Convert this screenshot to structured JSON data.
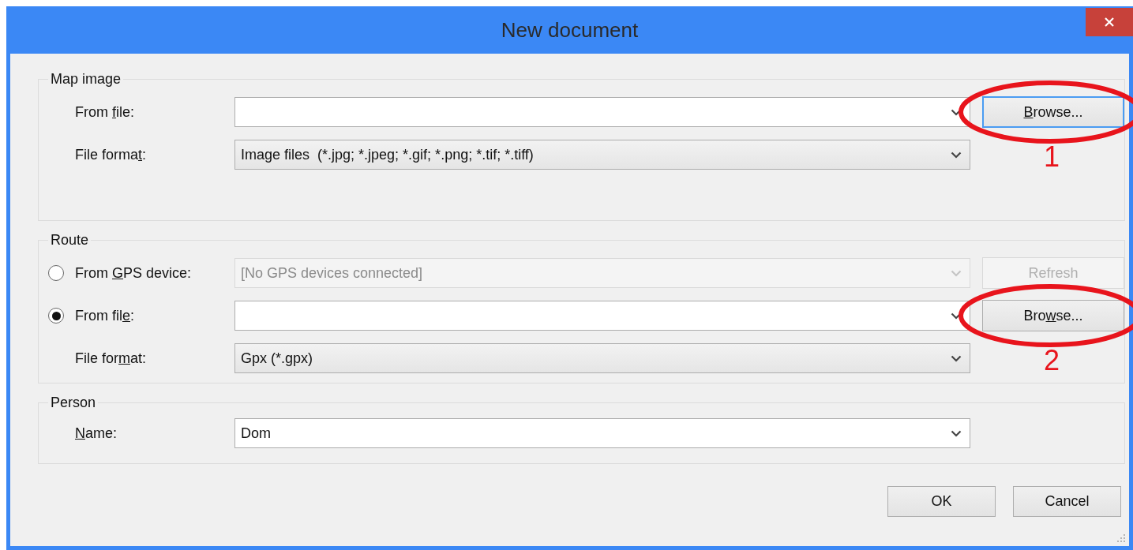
{
  "window": {
    "title": "New document"
  },
  "groups": [
    {
      "title": "Map image",
      "rows": [
        {
          "label": {
            "before": "From ",
            "key": "f",
            "after": "ile:"
          },
          "field": {
            "kind": "editable",
            "disabled": false
          },
          "button": {
            "key": "B",
            "after": "rowse...",
            "focused": true,
            "disabled": false,
            "annotation": "1"
          }
        },
        {
          "label": {
            "before": "File forma",
            "key": "t",
            "after": ":"
          },
          "field": {
            "kind": "dropdown",
            "value": "Image files  (*.jpg; *.jpeg; *.gif; *.png; *.tif; *.tiff)",
            "disabled": false
          }
        }
      ]
    },
    {
      "title": "Route",
      "rows": [
        {
          "radio": {
            "selected": false
          },
          "label": {
            "before": "From ",
            "key": "G",
            "after": "PS device:"
          },
          "field": {
            "kind": "dropdown",
            "value": "[No GPS devices connected]",
            "disabled": true
          },
          "button": {
            "before": "Refresh",
            "focused": false,
            "disabled": true
          }
        },
        {
          "radio": {
            "selected": true
          },
          "label": {
            "before": "From fil",
            "key": "e",
            "after": ":"
          },
          "field": {
            "kind": "editable",
            "disabled": false
          },
          "button": {
            "before": "Bro",
            "key": "w",
            "after": "se...",
            "focused": false,
            "disabled": false,
            "annotation": "2"
          }
        },
        {
          "label": {
            "before": "File for",
            "key": "m",
            "after": "at:"
          },
          "field": {
            "kind": "dropdown",
            "value": "Gpx (*.gpx)",
            "disabled": false
          }
        }
      ]
    },
    {
      "title": "Person",
      "rows": [
        {
          "label": {
            "key": "N",
            "after": "ame:"
          },
          "field": {
            "kind": "editable",
            "value": "Dom",
            "disabled": false
          }
        }
      ]
    }
  ],
  "buttons": [
    {
      "label": "OK"
    },
    {
      "label": "Cancel"
    }
  ]
}
